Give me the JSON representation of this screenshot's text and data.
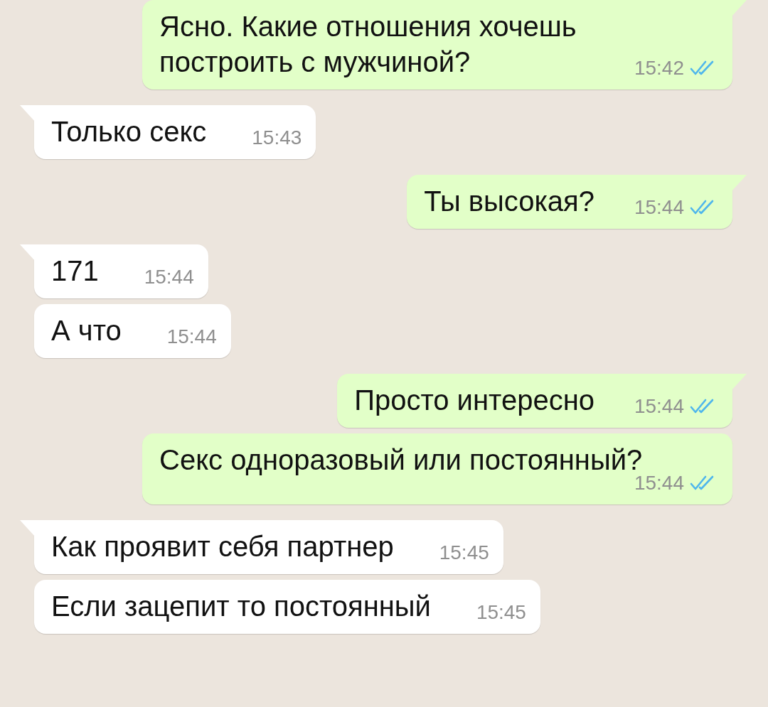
{
  "messages": [
    {
      "kind": "outgoing",
      "text": "Ясно. Какие отношения хочешь построить с мужчиной?",
      "time": "15:42",
      "read": true,
      "tail": true
    },
    {
      "kind": "incoming",
      "text": "Только секс",
      "time": "15:43",
      "tail": true
    },
    {
      "kind": "outgoing",
      "text": "Ты высокая?",
      "time": "15:44",
      "read": true,
      "tail": true
    },
    {
      "kind": "incoming",
      "text": "171",
      "time": "15:44",
      "tail": true
    },
    {
      "kind": "incoming",
      "text": "А что",
      "time": "15:44",
      "tail": false
    },
    {
      "kind": "outgoing",
      "text": "Просто интересно",
      "time": "15:44",
      "read": true,
      "tail": true
    },
    {
      "kind": "outgoing",
      "text": "Секс одноразовый или постоянный?",
      "time": "15:44",
      "read": true,
      "tail": false
    },
    {
      "kind": "incoming",
      "text": "Как проявит себя партнер",
      "time": "15:45",
      "tail": true
    },
    {
      "kind": "incoming",
      "text": "Если зацепит то постоянный",
      "time": "15:45",
      "tail": false
    }
  ]
}
